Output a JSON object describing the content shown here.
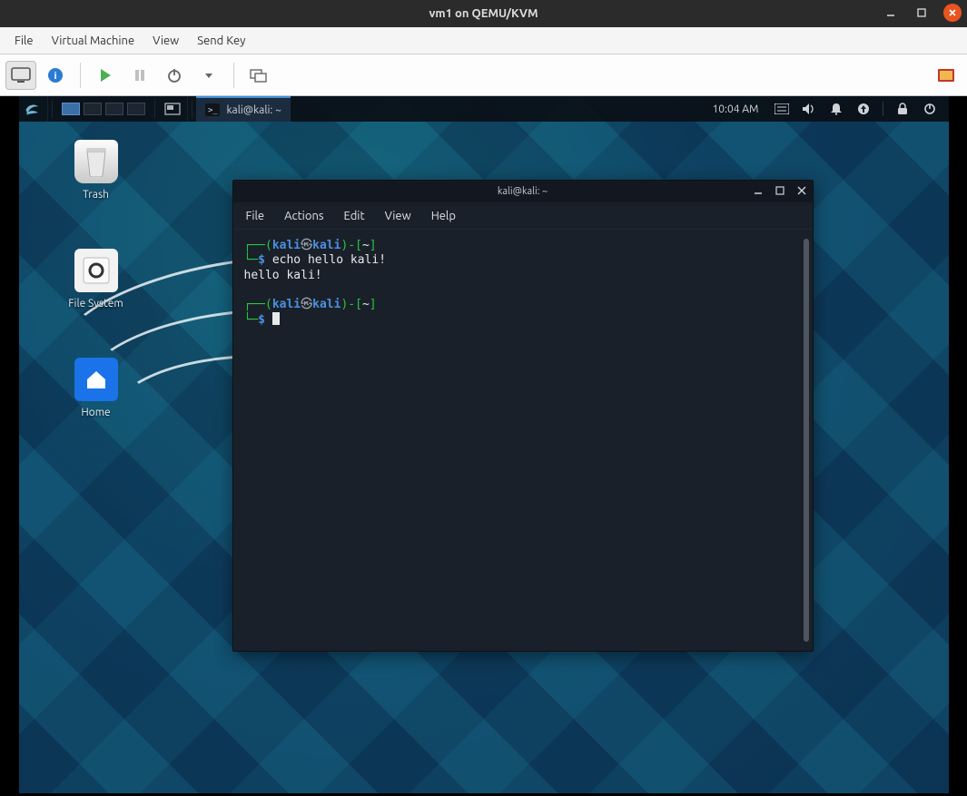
{
  "outer": {
    "title": "vm1 on QEMU/KVM",
    "menubar": {
      "file": "File",
      "vm": "Virtual Machine",
      "view": "View",
      "sendkey": "Send Key"
    }
  },
  "kali_panel": {
    "task_title": "kali@kali: ~",
    "time": "10:04 AM"
  },
  "desktop": {
    "trash": "Trash",
    "filesystem": "File System",
    "home": "Home"
  },
  "terminal": {
    "title": "kali@kali: ~",
    "menu": {
      "file": "File",
      "actions": "Actions",
      "edit": "Edit",
      "view": "View",
      "help": "Help"
    },
    "prompt": {
      "open": "┌──(",
      "user": "kali",
      "sep": "㉿",
      "host": "kali",
      "close_a": ")-[",
      "cwd": "~",
      "close_b": "]",
      "line2": "└─",
      "dollar": "$"
    },
    "command": "echo hello kali!",
    "output": "hello kali!"
  }
}
